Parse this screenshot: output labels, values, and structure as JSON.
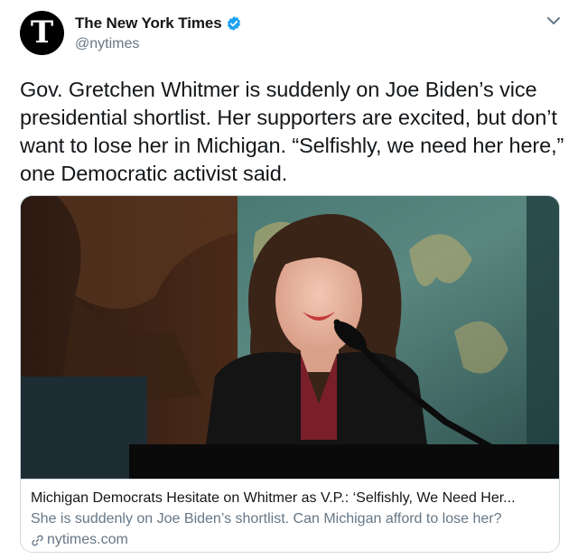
{
  "author": {
    "avatar_glyph": "T",
    "name": "The New York Times",
    "handle": "@nytimes",
    "verified": true
  },
  "tweet": {
    "text": "Gov. Gretchen Whitmer is suddenly on Joe Biden’s vice presidential shortlist. Her supporters are excited, but don’t want to lose her in Michigan. “Selfishly, we need her here,” one Democratic activist said."
  },
  "card": {
    "title": "Michigan Democrats Hesitate on Whitmer as V.P.: ‘Selfishly, We Need Her...",
    "description": "She is suddenly on Joe Biden’s shortlist. Can Michigan afford to lose her?",
    "domain": "nytimes.com"
  },
  "icons": {
    "verified": "verified-badge-icon",
    "caret": "chevron-down-icon",
    "link": "link-icon"
  },
  "colors": {
    "verified_blue": "#1da1f2",
    "secondary_text": "#657786",
    "border": "#cfd9de"
  }
}
